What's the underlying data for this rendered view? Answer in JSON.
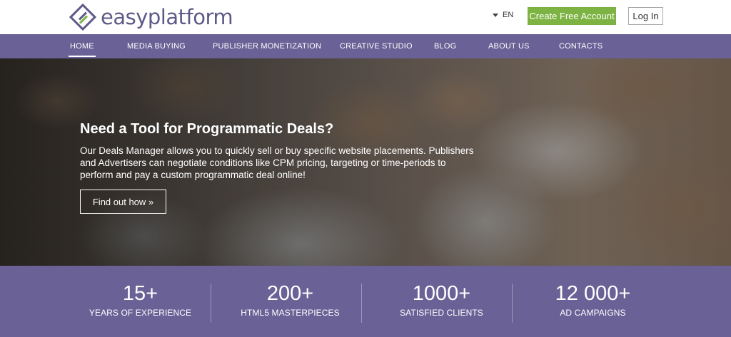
{
  "header": {
    "logo_text": "easyplatform",
    "language": "EN",
    "create_account_label": "Create Free Account",
    "login_label": "Log In"
  },
  "nav": {
    "items": [
      {
        "label": "HOME",
        "active": true
      },
      {
        "label": "MEDIA BUYING"
      },
      {
        "label": "PUBLISHER MONETIZATION"
      },
      {
        "label": "CREATIVE STUDIO"
      },
      {
        "label": "BLOG"
      },
      {
        "label": "ABOUT US"
      },
      {
        "label": "CONTACTS"
      }
    ]
  },
  "hero": {
    "title": "Need a Tool for Programmatic Deals?",
    "description": "Our Deals Manager allows you to quickly sell or buy specific website placements. Publishers and Advertisers can negotiate conditions like CPM pricing, targeting or time-periods to perform and pay a custom programmatic deal online!",
    "cta_label": "Find out how »"
  },
  "stats": [
    {
      "number": "15+",
      "label": "YEARS OF EXPERIENCE"
    },
    {
      "number": "200+",
      "label": "HTML5 MASTERPIECES"
    },
    {
      "number": "1000+",
      "label": "SATISFIED CLIENTS"
    },
    {
      "number": "12 000+",
      "label": "AD CAMPAIGNS"
    }
  ],
  "colors": {
    "brand_purple": "#6a6196",
    "logo_purple": "#5d5a88",
    "accent_green": "#7cb342"
  },
  "icons": {
    "logo": "easyplatform-logo-icon",
    "language_caret": "caret-down-icon"
  }
}
